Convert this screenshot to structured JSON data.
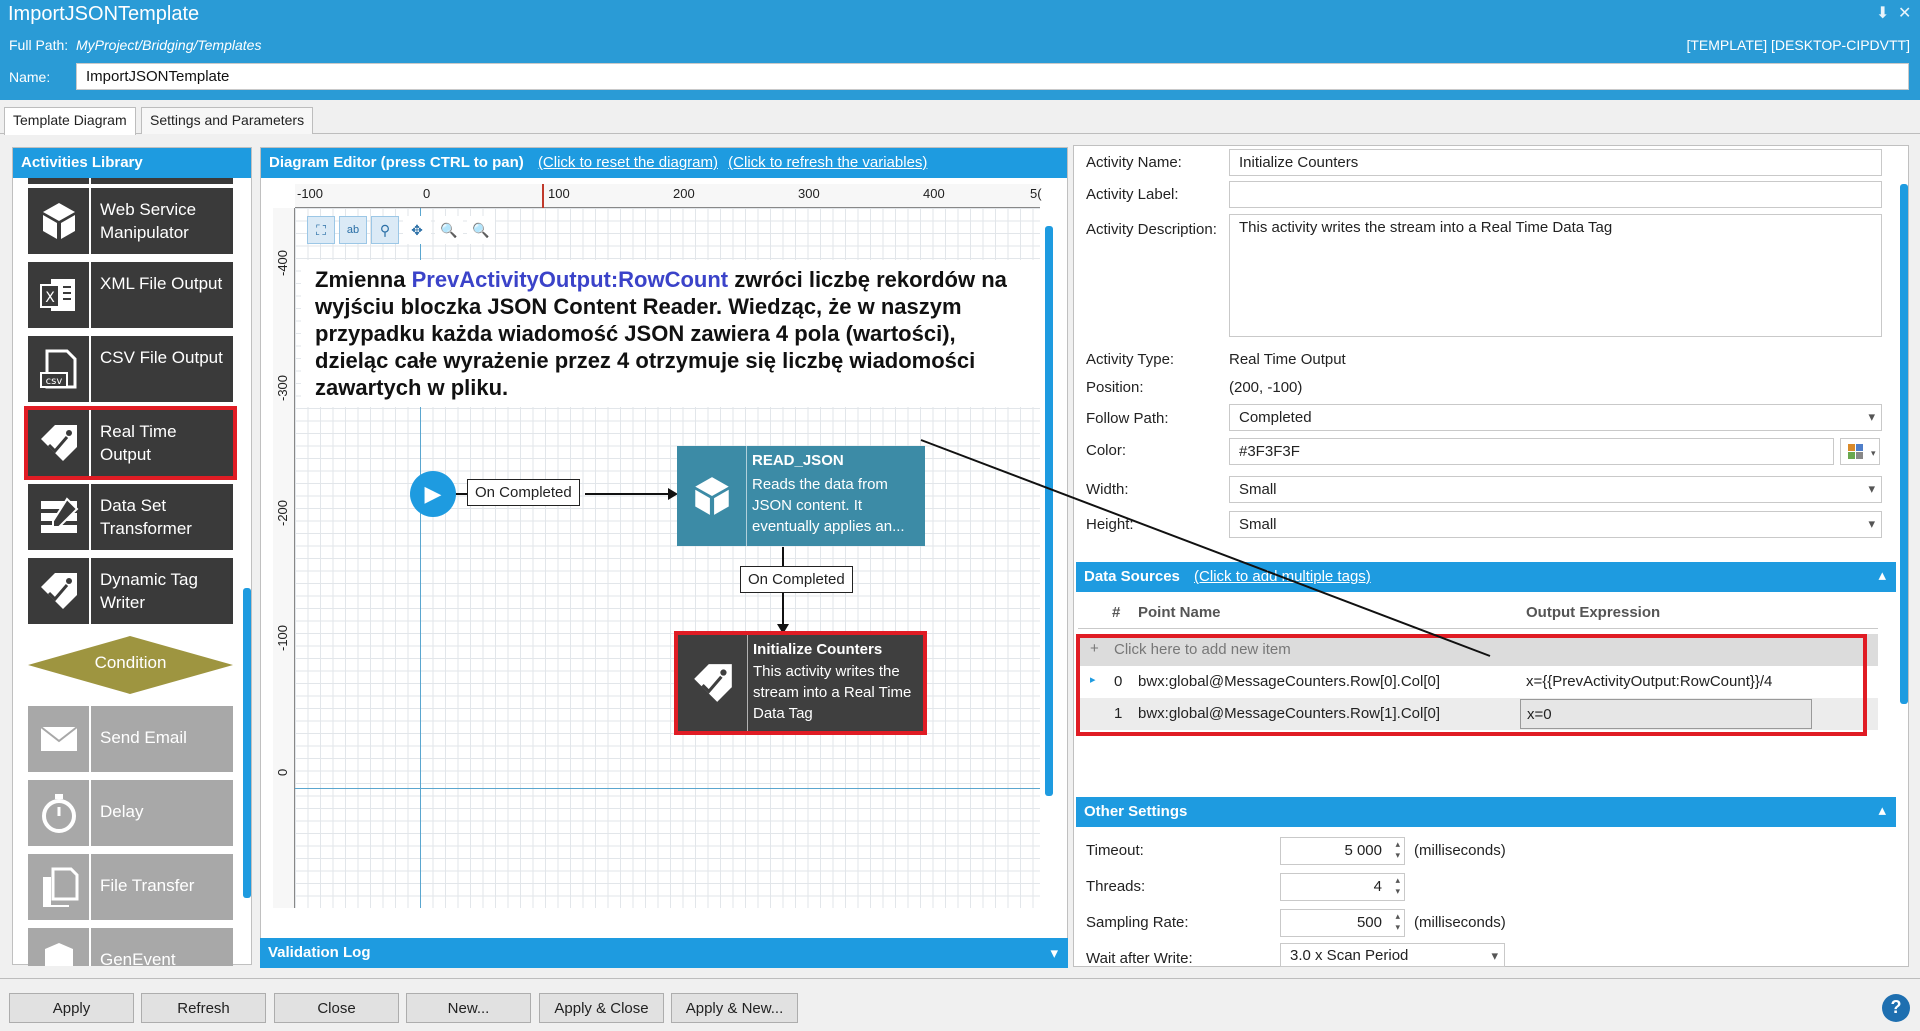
{
  "window": {
    "title": "ImportJSONTemplate"
  },
  "header": {
    "path_label": "Full Path:",
    "path_value": "MyProject/Bridging/Templates",
    "host": "[TEMPLATE] [DESKTOP-CIPDVTT]",
    "name_label": "Name:",
    "name_value": "ImportJSONTemplate"
  },
  "tabs": [
    {
      "label": "Template Diagram",
      "active": true
    },
    {
      "label": "Settings and Parameters",
      "active": false
    }
  ],
  "library": {
    "title": "Activities Library",
    "items": [
      {
        "label": "Web Service Manipulator",
        "icon": "cube-icon"
      },
      {
        "label": "XML File Output",
        "icon": "xml-file-icon"
      },
      {
        "label": "CSV File Output",
        "icon": "csv-file-icon"
      },
      {
        "label": "Real Time Output",
        "icon": "tag-icon",
        "selected": true
      },
      {
        "label": "Data Set Transformer",
        "icon": "dataset-icon"
      },
      {
        "label": "Dynamic Tag Writer",
        "icon": "dynamic-tag-icon"
      },
      {
        "label": "Condition",
        "icon": "diamond-icon"
      },
      {
        "label": "Send Email",
        "icon": "email-icon"
      },
      {
        "label": "Delay",
        "icon": "stopwatch-icon"
      },
      {
        "label": "File Transfer",
        "icon": "files-icon"
      },
      {
        "label": "GenEvent",
        "icon": "event-icon"
      }
    ]
  },
  "editor": {
    "title": "Diagram Editor (press CTRL to pan)",
    "link_reset": "(Click to reset the diagram)",
    "link_refresh": "(Click to refresh the variables)",
    "ruler_top": [
      "-100",
      "0",
      "100",
      "200",
      "300",
      "400",
      "5("
    ],
    "ruler_left": [
      "-400",
      "-300",
      "-200",
      "-100",
      "0"
    ],
    "note": {
      "part1": "Zmienna ",
      "highlight": "PrevActivityOutput:RowCount",
      "part2": " zwróci liczbę rekordów na wyjściu bloczka JSON Content Reader. Wiedząc, że w naszym przypadku każda wiadomość JSON zawiera 4 pola (wartości), dzieląc całe wyrażenie przez 4 otrzymuje się liczbę wiadomości zawartych w pliku."
    },
    "connector1": "On Completed",
    "connector2": "On Completed",
    "node_read": {
      "title": "READ_JSON",
      "desc": "Reads the data from JSON content. It eventually applies an...",
      "color": "#3c8ba6"
    },
    "node_init": {
      "title": "Initialize Counters",
      "desc": "This activity writes the stream into a Real Time Data Tag",
      "color": "#3f3f3f"
    }
  },
  "validation": {
    "title": "Validation Log"
  },
  "properties": {
    "activity_name_label": "Activity Name:",
    "activity_name": "Initialize Counters",
    "activity_label_label": "Activity Label:",
    "activity_label": "",
    "activity_desc_label": "Activity Description:",
    "activity_desc": "This activity writes the stream into a Real Time Data Tag",
    "activity_type_label": "Activity Type:",
    "activity_type": "Real Time Output",
    "position_label": "Position:",
    "position": "(200, -100)",
    "follow_path_label": "Follow Path:",
    "follow_path": "Completed",
    "color_label": "Color:",
    "color": "#3F3F3F",
    "width_label": "Width:",
    "width": "Small",
    "height_label": "Height:",
    "height": "Small"
  },
  "data_sources": {
    "title": "Data Sources",
    "link": "(Click to add multiple tags)",
    "col_num": "#",
    "col_point": "Point Name",
    "col_expr": "Output Expression",
    "add_row": "Click here to add new item",
    "rows": [
      {
        "num": "0",
        "point": "bwx:global@MessageCounters.Row[0].Col[0]",
        "expr": "x={{PrevActivityOutput:RowCount}}/4"
      },
      {
        "num": "1",
        "point": "bwx:global@MessageCounters.Row[1].Col[0]",
        "expr": "x=0"
      }
    ]
  },
  "other_settings": {
    "title": "Other Settings",
    "timeout_label": "Timeout:",
    "timeout": "5 000",
    "timeout_unit": "(milliseconds)",
    "threads_label": "Threads:",
    "threads": "4",
    "sampling_label": "Sampling Rate:",
    "sampling": "500",
    "sampling_unit": "(milliseconds)",
    "wait_label": "Wait after Write:",
    "wait": "3.0 x Scan Period"
  },
  "footer": {
    "apply": "Apply",
    "refresh": "Refresh",
    "close": "Close",
    "new": "New...",
    "apply_close": "Apply & Close",
    "apply_new": "Apply & New...",
    "help": "?"
  }
}
